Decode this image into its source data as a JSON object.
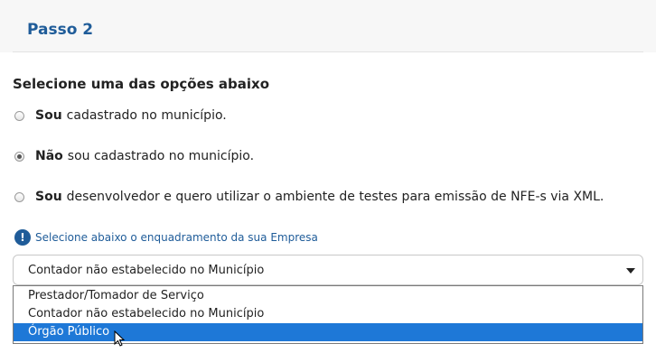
{
  "step": {
    "title": "Passo 2"
  },
  "section": {
    "title": "Selecione uma das opções abaixo"
  },
  "options": [
    {
      "bold": "Sou",
      "text": "cadastrado no município.",
      "checked": false
    },
    {
      "bold": "Não",
      "text": "sou cadastrado no município.",
      "checked": true
    },
    {
      "bold": "Sou",
      "text": "desenvolvedor e quero utilizar o ambiente de testes para emissão de NFE-s via XML.",
      "checked": false
    }
  ],
  "hint": {
    "icon": "info-icon",
    "text": "Selecione abaixo o enquadramento da sua Empresa"
  },
  "select": {
    "value": "Contador não estabelecido no Município",
    "options": [
      "Prestador/Tomador de Serviço",
      "Contador não estabelecido no Município",
      "Órgão Público"
    ],
    "highlighted_index": 2
  },
  "colors": {
    "accent": "#1f5c99",
    "highlight": "#1e78d7"
  }
}
